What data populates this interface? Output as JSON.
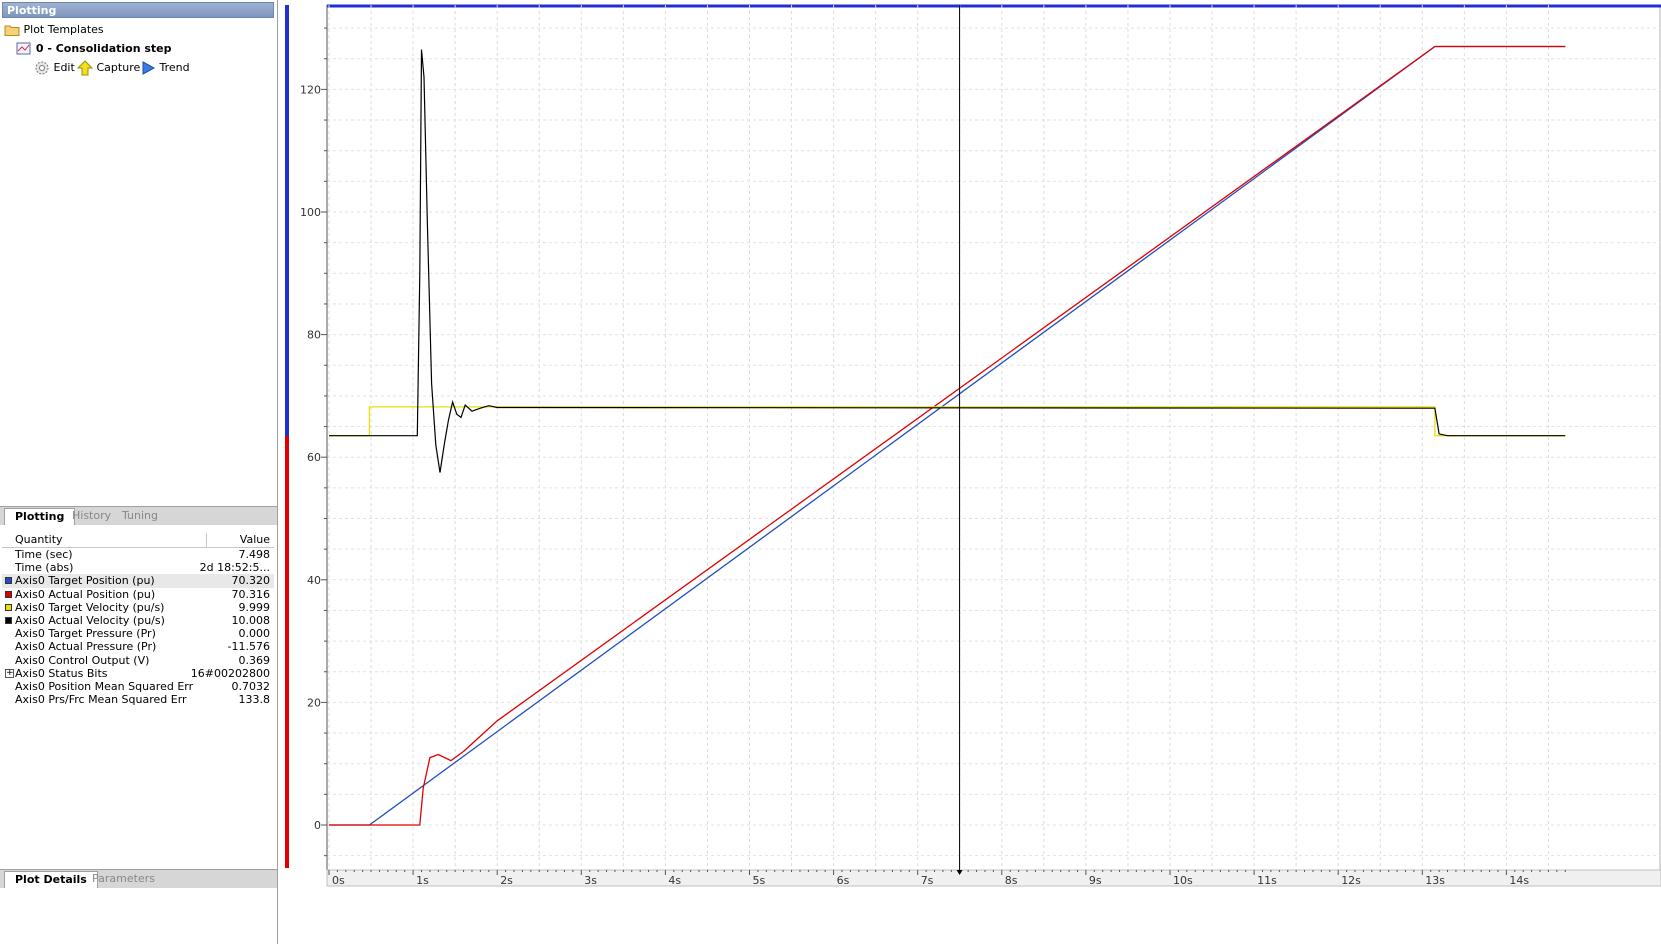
{
  "panel": {
    "title": "Plotting",
    "tree_root": "Plot Templates",
    "template_item": "0 - Consolidation step",
    "actions": {
      "edit": "Edit",
      "capture": "Capture",
      "trend": "Trend"
    }
  },
  "tabs_top": [
    {
      "label": "Plotting",
      "active": true
    },
    {
      "label": "History",
      "active": false
    },
    {
      "label": "Tuning",
      "active": false
    }
  ],
  "details": {
    "col_quantity": "Quantity",
    "col_value": "Value",
    "rows": [
      {
        "q": "Time (sec)",
        "v": "7.498",
        "color": ""
      },
      {
        "q": "Time (abs)",
        "v": "2d 18:52:5...",
        "color": ""
      },
      {
        "q": "Axis0 Target Position (pu)",
        "v": "70.320",
        "color": "#1f4fbf"
      },
      {
        "q": "Axis0 Actual Position (pu)",
        "v": "70.316",
        "color": "#e00000"
      },
      {
        "q": "Axis0 Target Velocity (pu/s)",
        "v": "9.999",
        "color": "#e8e000"
      },
      {
        "q": "Axis0 Actual Velocity (pu/s)",
        "v": "10.008",
        "color": "#000000"
      },
      {
        "q": "Axis0 Target Pressure (Pr)",
        "v": "0.000",
        "color": ""
      },
      {
        "q": "Axis0 Actual Pressure (Pr)",
        "v": "-11.576",
        "color": ""
      },
      {
        "q": "Axis0 Control Output (V)",
        "v": "0.369",
        "color": ""
      },
      {
        "q": "Axis0 Status Bits",
        "v": "16#00202800",
        "color": "",
        "expandable": true
      },
      {
        "q": "Axis0 Position Mean Squared Err",
        "v": "0.7032",
        "color": ""
      },
      {
        "q": "Axis0 Prs/Frc Mean Squared Err",
        "v": "133.8",
        "color": ""
      }
    ]
  },
  "tabs_bottom": [
    {
      "label": "Plot Details",
      "active": true
    },
    {
      "label": "Parameters",
      "active": false
    }
  ],
  "chart_data": {
    "type": "line",
    "x_unit": "s",
    "xlim": [
      0,
      14.7
    ],
    "ylim": [
      -7,
      134
    ],
    "x_ticks": [
      "0s",
      "1s",
      "2s",
      "3s",
      "4s",
      "5s",
      "6s",
      "7s",
      "8s",
      "9s",
      "10s",
      "11s",
      "12s",
      "13s",
      "14s"
    ],
    "y_ticks": [
      0,
      20,
      40,
      60,
      80,
      100,
      120
    ],
    "cursor_x": 7.498,
    "grid": true,
    "series": [
      {
        "name": "Axis0 Target Position (pu)",
        "color": "#1f4fbf",
        "x": [
          0,
          0.48,
          13.15,
          14.7
        ],
        "y": [
          0,
          0,
          127,
          127
        ]
      },
      {
        "name": "Axis0 Actual Position (pu)",
        "color": "#e00000",
        "x": [
          0,
          1.08,
          1.12,
          1.2,
          1.3,
          1.45,
          1.6,
          1.8,
          2.0,
          13.15,
          14.7
        ],
        "y": [
          0,
          0,
          6,
          11,
          11.5,
          10.5,
          12,
          14.5,
          17,
          127,
          127
        ]
      },
      {
        "name": "Axis0 Target Velocity (pu/s)",
        "color": "#e8e000",
        "x": [
          0,
          0.48,
          0.48,
          13.15,
          13.15,
          14.7
        ],
        "y": [
          63.5,
          63.5,
          68.2,
          68.2,
          63.5,
          63.5
        ]
      },
      {
        "name": "Axis0 Actual Velocity (pu/s)",
        "color": "#000000",
        "x": [
          0,
          1.05,
          1.08,
          1.1,
          1.13,
          1.17,
          1.22,
          1.27,
          1.32,
          1.37,
          1.42,
          1.47,
          1.52,
          1.57,
          1.62,
          1.7,
          1.8,
          1.9,
          2.0,
          13.15,
          13.2,
          13.3,
          14.7
        ],
        "y": [
          63.5,
          63.5,
          90,
          126.5,
          122,
          98,
          72,
          62,
          57.5,
          62,
          66,
          69,
          67,
          66.5,
          68.5,
          67.5,
          68,
          68.4,
          68.1,
          68,
          63.8,
          63.5,
          63.5
        ]
      }
    ]
  }
}
